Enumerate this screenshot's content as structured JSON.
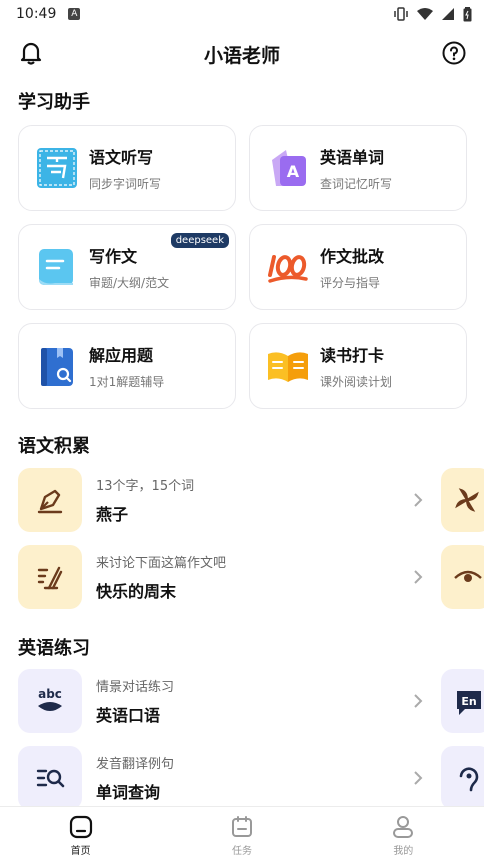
{
  "status_bar": {
    "time": "10:49",
    "notification": "A"
  },
  "header": {
    "title": "小语老师"
  },
  "sections": {
    "assistant": "学习助手",
    "chinese": "语文积累",
    "english": "英语练习"
  },
  "cards": [
    {
      "name": "语文听写",
      "sub": "同步字词听写"
    },
    {
      "name": "英语单词",
      "sub": "查词记忆听写"
    },
    {
      "name": "写作文",
      "sub": "审题/大纲/范文",
      "badge": "deepseek"
    },
    {
      "name": "作文批改",
      "sub": "评分与指导"
    },
    {
      "name": "解应用题",
      "sub": "1对1解题辅导"
    },
    {
      "name": "读书打卡",
      "sub": "课外阅读计划"
    }
  ],
  "chinese_items": [
    {
      "sub": "13个字，15个词",
      "name": "燕子"
    },
    {
      "sub": "来讨论下面这篇作文吧",
      "name": "快乐的周末"
    }
  ],
  "english_items": [
    {
      "sub": "情景对话练习",
      "name": "英语口语"
    },
    {
      "sub": "发音翻译例句",
      "name": "单词查询"
    }
  ],
  "english_icon_text": {
    "abc": "abc",
    "en": "En"
  },
  "tabs": [
    {
      "label": "首页",
      "active": true
    },
    {
      "label": "任务",
      "active": false
    },
    {
      "label": "我的",
      "active": false
    }
  ],
  "colors": {
    "card_yellow": "#fdf0cc",
    "card_purple": "#efeefc",
    "badge": "#1e3a64"
  }
}
